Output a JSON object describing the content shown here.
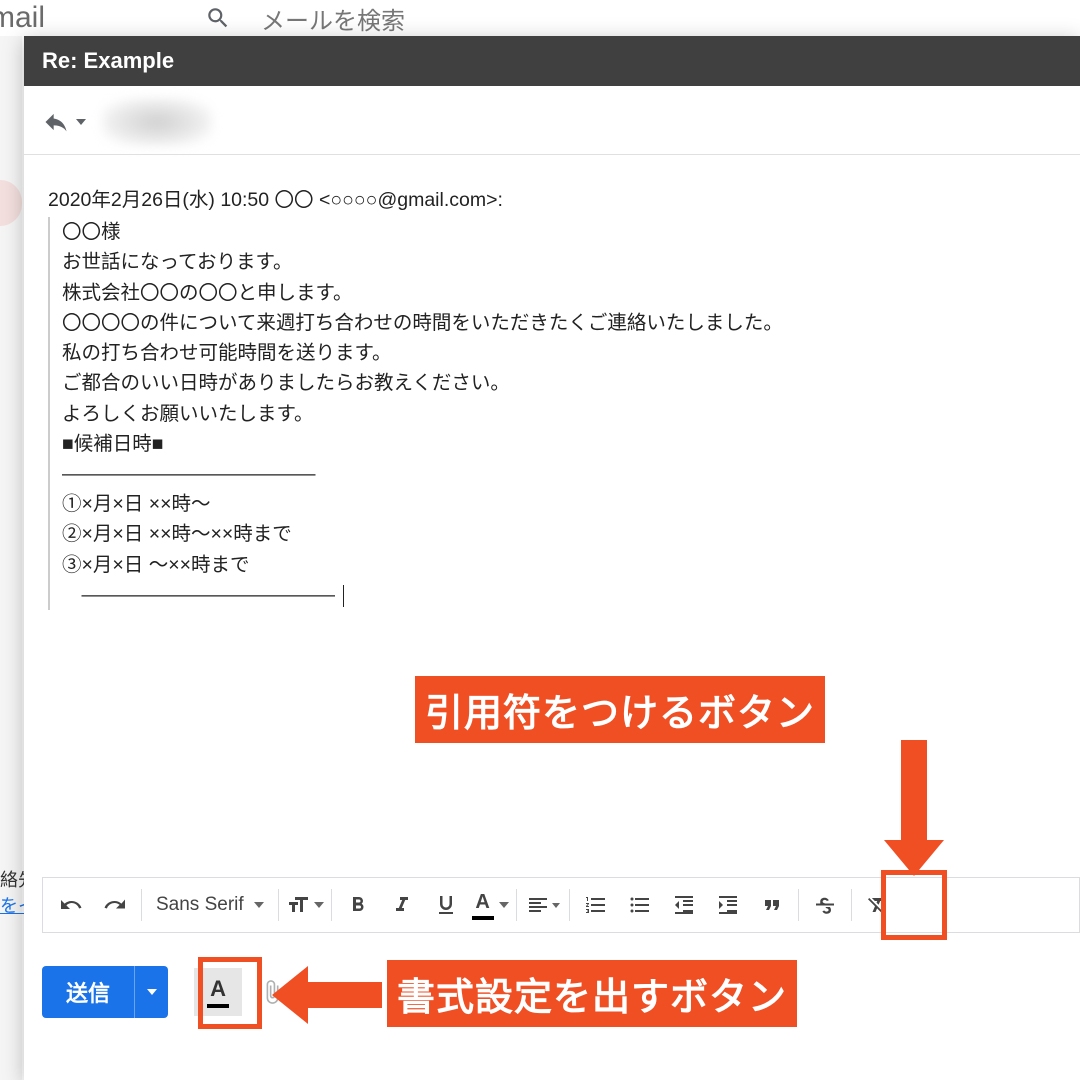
{
  "background": {
    "logo_fragment": "mail",
    "search_placeholder": "メールを検索",
    "left_text_line1": "絡先",
    "left_text_line2": "をイ"
  },
  "compose": {
    "title": "Re: Example",
    "reply_line": "2020年2月26日(水) 10:50 〇〇 <○○○○@gmail.com>:",
    "quoted": {
      "l1": "〇〇様",
      "l2": "",
      "l3": "お世話になっております。",
      "l4": "株式会社〇〇の〇〇と申します。",
      "l5": "",
      "l6": "〇〇〇〇の件について来週打ち合わせの時間をいただきたくご連絡いたしました。",
      "l7": "",
      "l8": "私の打ち合わせ可能時間を送ります。",
      "l9": "ご都合のいい日時がありましたらお教えください。",
      "l10": "よろしくお願いいたします。",
      "l11": "",
      "l12": "■候補日時■",
      "l13": "―――――――――――――",
      "l14": "①×月×日 ××時～",
      "l15": "②×月×日 ××時～××時まで",
      "l16": "③×月×日 ～××時まで",
      "l17": "　―――――――――――――"
    }
  },
  "toolbar": {
    "font": "Sans Serif"
  },
  "send": {
    "label": "送信"
  },
  "callouts": {
    "quote": "引用符をつけるボタン",
    "format": "書式設定を出すボタン"
  }
}
